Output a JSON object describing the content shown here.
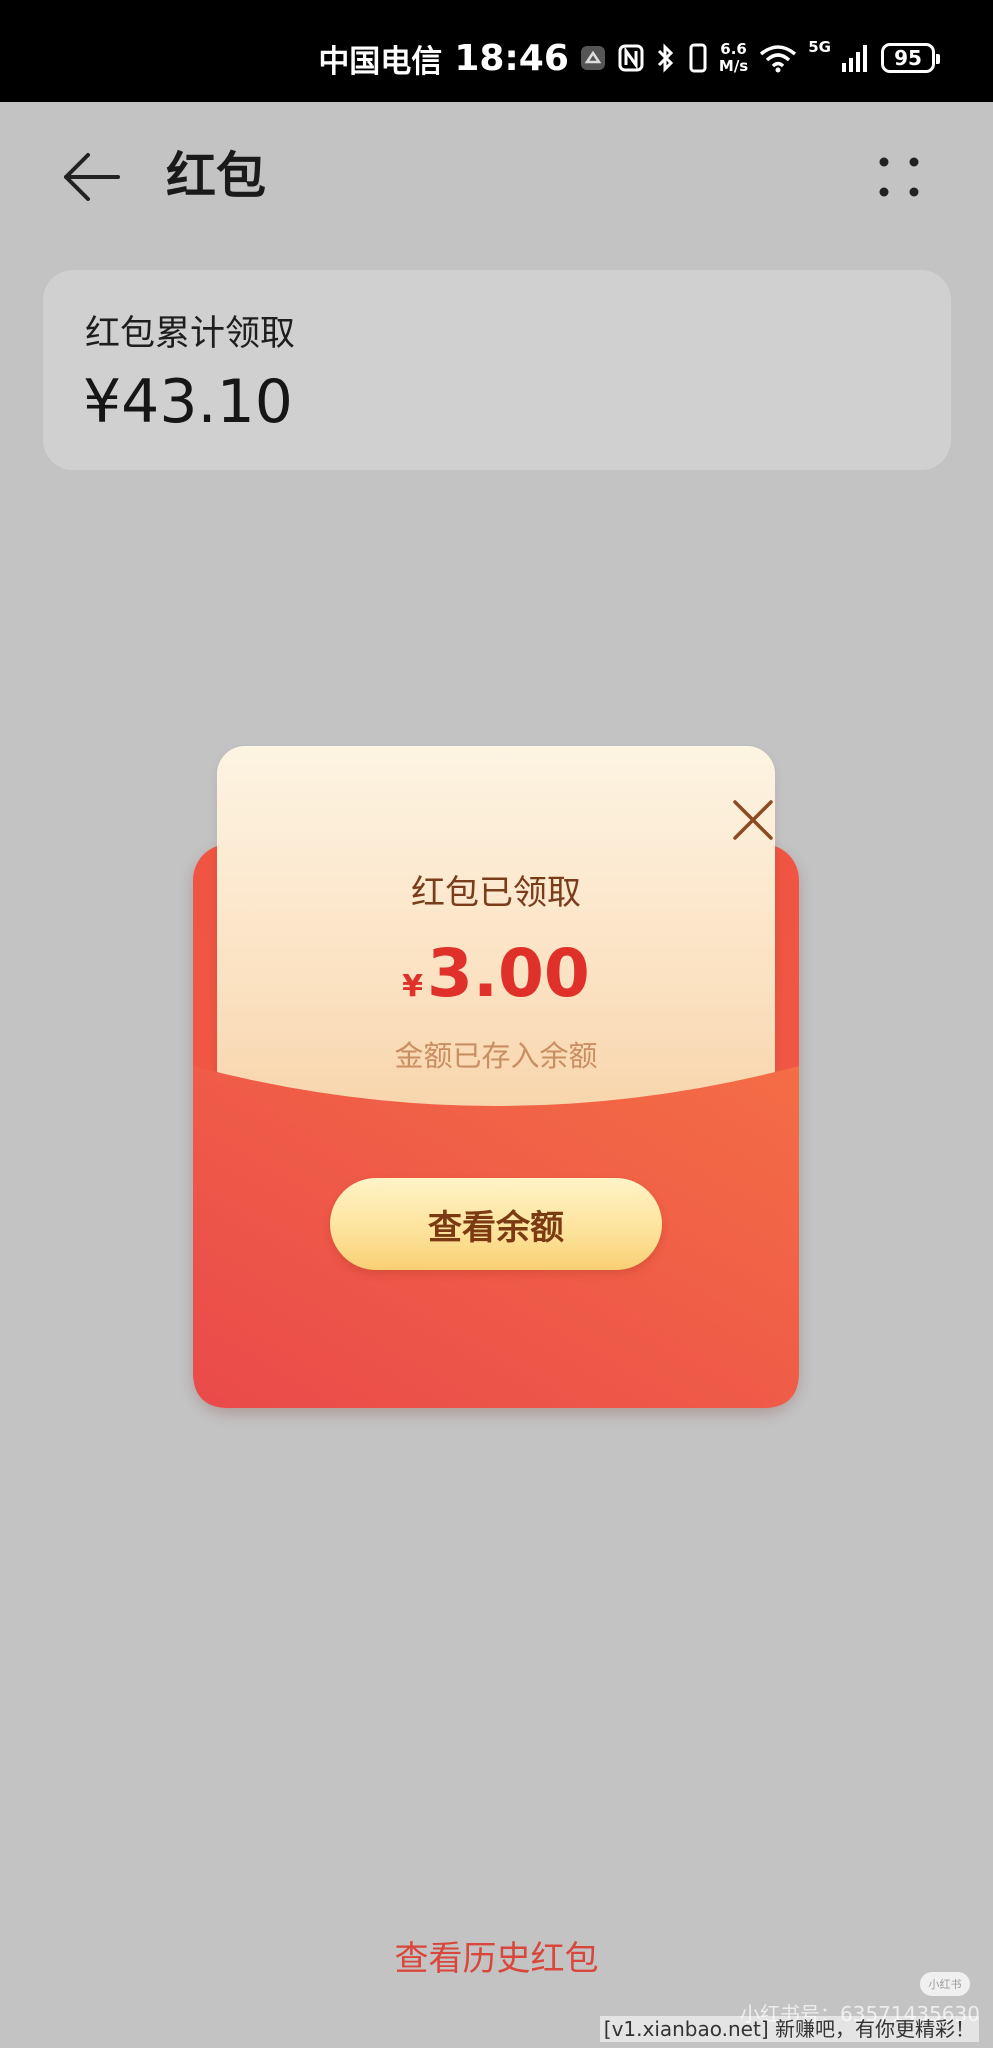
{
  "status_bar": {
    "carrier": "中国电信",
    "time": "18:46",
    "net_speed_value": "6.6",
    "net_speed_unit": "M/s",
    "network_type": "5G",
    "battery": "95",
    "icons": [
      "app-notification-icon",
      "nfc-icon",
      "bluetooth-icon",
      "vibrate-icon",
      "wifi-icon",
      "signal-icon",
      "battery-icon"
    ]
  },
  "header": {
    "title": "红包",
    "back_icon": "back-arrow-icon",
    "more_icon": "more-dots-icon"
  },
  "summary": {
    "label": "红包累计领取",
    "amount": "¥43.10"
  },
  "packet": {
    "title": "红包已领取",
    "currency": "¥",
    "amount": "3.00",
    "note": "金额已存入余额",
    "button_label": "查看余额",
    "close_icon": "close-icon",
    "colors": {
      "envelope": "#ef5744",
      "letter": "#fbe3c4",
      "amount": "#e0302a",
      "button": "#fde29a"
    }
  },
  "footer": {
    "history_link": "查看历史红包",
    "watermark_badge": "小红书",
    "watermark_id": "小红书号：63571435630",
    "watermark_site": "[v1.xianbao.net] 新赚吧，有你更精彩！"
  }
}
